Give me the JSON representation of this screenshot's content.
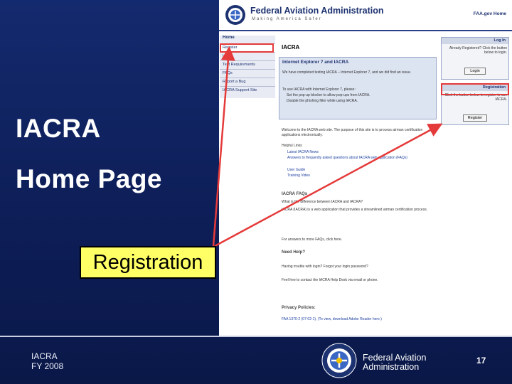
{
  "slide": {
    "title_line1": "IACRA",
    "title_line2": "Home Page",
    "callout": "Registration",
    "footer": {
      "left_line1": "IACRA",
      "left_line2": "FY 2008",
      "agency_line1": "Federal Aviation",
      "agency_line2": "Administration",
      "page_number": "17"
    }
  },
  "web": {
    "header": {
      "agency_name": "Federal Aviation Administration",
      "motto": "Making America Safer",
      "home_link": "FAA.gov Home"
    },
    "nav": {
      "heading": "Home",
      "items": [
        "Register",
        "Login",
        "Test Requirements",
        "FAQs",
        "Report a Bug",
        "IACRA Support Site"
      ]
    },
    "page_heading": "IACRA",
    "ie_box": {
      "title": "Internet Explorer 7 and IACRA",
      "text1": "We have completed testing IACRA – Internet Explorer 7, and we did find an issue.",
      "text2": "To use IACRA with Internet Explorer 7, please:",
      "bullet1": "Set the pop-up blocker to allow pop-ups from IACRA.",
      "bullet2": "Disable the phishing filter while using IACRA."
    },
    "login_box": {
      "title": "Log In",
      "text": "Already Registered? Click the button below to login.",
      "button": "Login"
    },
    "registration_box": {
      "title": "Registration",
      "text": "Click the button below to register to use IACRA.",
      "button": "Register"
    },
    "welcome": "Welcome to the IACRA web site. The purpose of this site is to process airman certification applications electronically.",
    "helpful_links": "Helpful Links",
    "links": [
      "Latest IACRA News",
      "Answers to frequently asked questions about IACRA web application (FAQs)",
      "User Guide",
      "Training Video"
    ],
    "faq_heading": "IACRA FAQs",
    "faq_text1": "What is the difference between IACRA and IACRA?",
    "faq_text2": "IACRA (IACRA) is a web application that provides a streamlined airman certification process.",
    "faq_text3": "For answers to more FAQs, click here.",
    "help_heading": "Need Help?",
    "help_text1": "Having trouble with login? Forgot your login password?",
    "help_text2": "Feel free to contact the IACRA Help Desk via email or phone.",
    "privacy_heading": "Privacy Policies:",
    "privacy_text": "FAA 1370-2 (07-02-1), (To view, download Adobe Reader here.)"
  }
}
